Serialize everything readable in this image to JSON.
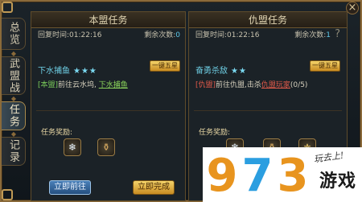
{
  "close_label": "×",
  "tabs": [
    {
      "label": "总览",
      "active": false
    },
    {
      "label": "武盟战",
      "active": false
    },
    {
      "label": "任务",
      "active": true
    },
    {
      "label": "记录",
      "active": false
    }
  ],
  "left_panel": {
    "title": "本盟任务",
    "refresh_label": "回复时间:01:22:16",
    "remain_label": "剩余次数:",
    "remain_value": "0",
    "quest_name": "下水捕鱼",
    "stars": "★★★",
    "onekey_label": "一键五星",
    "desc_tag": "[本盟]",
    "desc_text": "前往云水坞, ",
    "desc_link": "下水捕鱼",
    "reward_label": "任务奖励:",
    "rewards": [
      "❄",
      "⚱"
    ],
    "btn_go": "立即前往",
    "btn_finish": "立即完成"
  },
  "right_panel": {
    "title": "仇盟任务",
    "refresh_label": "回复时间:01:22:16",
    "remain_label": "剩余次数:",
    "remain_value": "1",
    "quest_name": "奋勇杀敌",
    "stars": "★★",
    "onekey_label": "一键五星",
    "desc_tag": "[仇盟]",
    "desc_text": "前往仇盟,击杀",
    "desc_link": "仇盟玩家",
    "progress": "(0/5)",
    "help": "?",
    "reward_label": "任务奖励:",
    "rewards": [
      "❄",
      "⚱",
      "⚜"
    ]
  },
  "watermark": {
    "digits": [
      "9",
      "7",
      "3"
    ],
    "text": "游戏",
    "handwriting": "玩去上!",
    "colors": {
      "d1": "#e8941e",
      "d2": "#2b9ee0",
      "d3": "#e8941e"
    }
  }
}
